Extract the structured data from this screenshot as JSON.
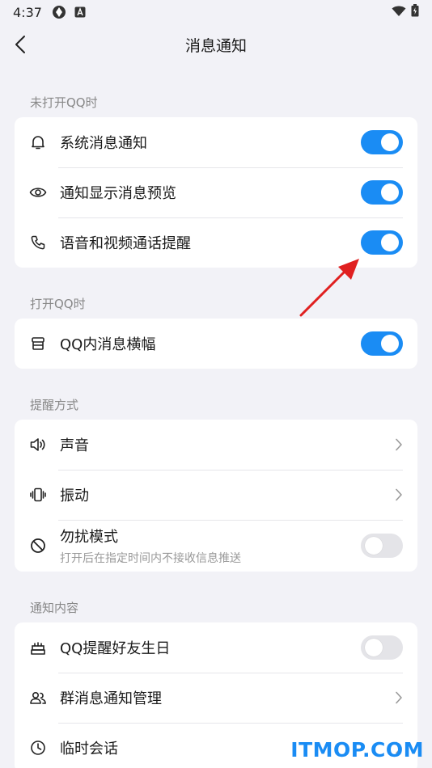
{
  "status_bar": {
    "time": "4:37"
  },
  "nav": {
    "title": "消息通知"
  },
  "sections": [
    {
      "label": "未打开QQ时",
      "items": [
        {
          "label": "系统消息通知",
          "icon": "bell-icon",
          "toggle": true
        },
        {
          "label": "通知显示消息预览",
          "icon": "eye-icon",
          "toggle": true
        },
        {
          "label": "语音和视频通话提醒",
          "icon": "phone-icon",
          "toggle": true
        }
      ]
    },
    {
      "label": "打开QQ时",
      "items": [
        {
          "label": "QQ内消息横幅",
          "icon": "banner-icon",
          "toggle": true
        }
      ]
    },
    {
      "label": "提醒方式",
      "items": [
        {
          "label": "声音",
          "icon": "speaker-icon"
        },
        {
          "label": "振动",
          "icon": "vibrate-icon"
        },
        {
          "label": "勿扰模式",
          "sublabel": "打开后在指定时间内不接收信息推送",
          "icon": "do-not-disturb-icon",
          "toggle": false
        }
      ]
    },
    {
      "label": "通知内容",
      "items": [
        {
          "label": "QQ提醒好友生日",
          "icon": "cake-icon",
          "toggle": false
        },
        {
          "label": "群消息通知管理",
          "icon": "group-icon"
        },
        {
          "label": "临时会话",
          "icon": "clock-icon"
        }
      ]
    }
  ],
  "watermark": "ITMOP.COM",
  "colors": {
    "accent": "#1a8cf4",
    "background": "#f2f2f7",
    "annotation_arrow": "#e02020"
  }
}
